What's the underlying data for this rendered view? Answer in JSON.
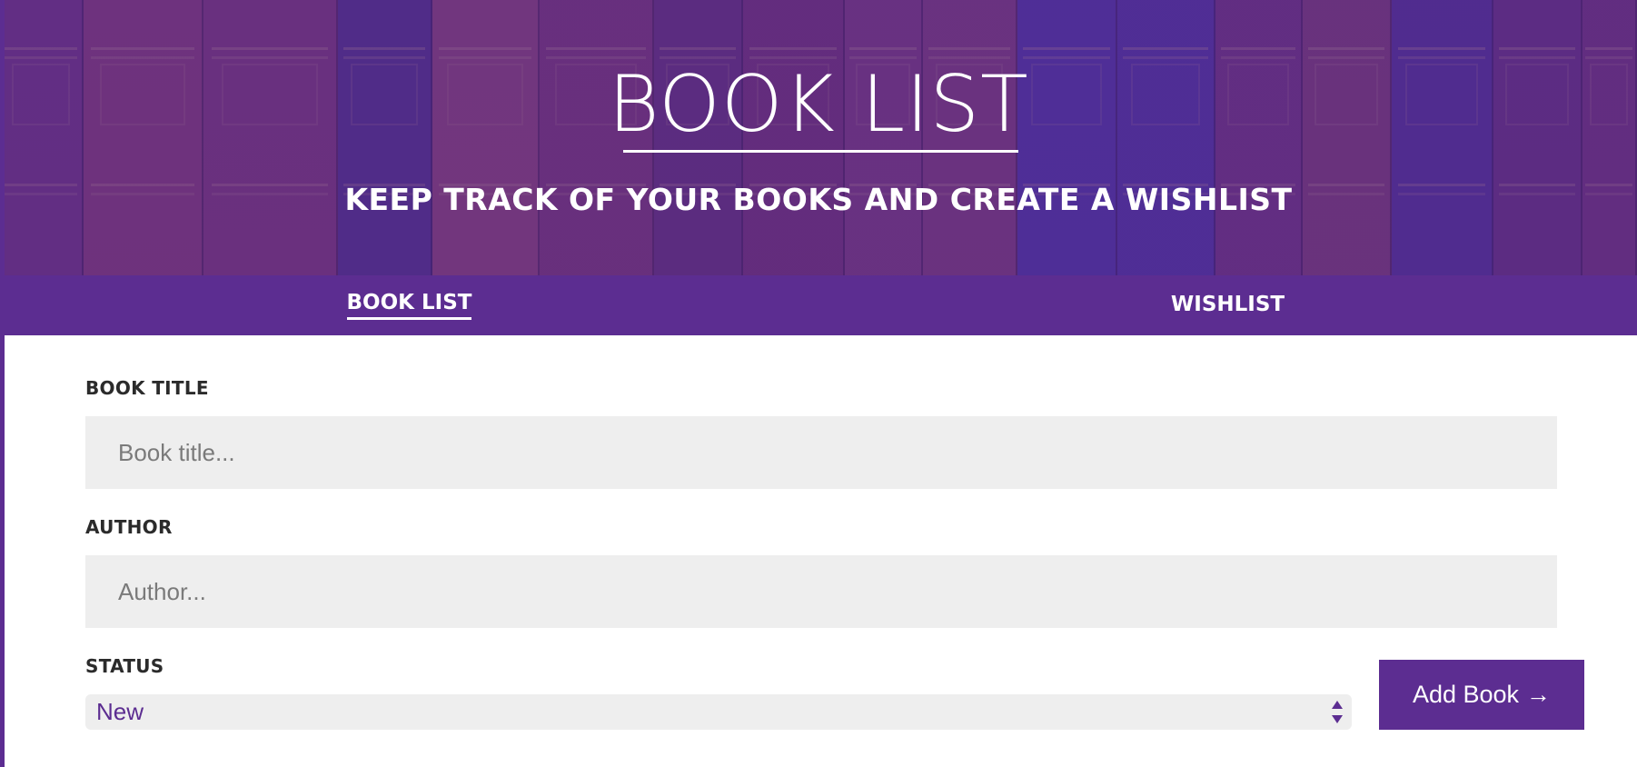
{
  "header": {
    "title": "BOOK LIST",
    "subtitle": "KEEP TRACK OF YOUR BOOKS AND CREATE A WISHLIST"
  },
  "nav": {
    "tabs": [
      {
        "label": "BOOK LIST",
        "active": true
      },
      {
        "label": "WISHLIST",
        "active": false
      }
    ]
  },
  "form": {
    "title": {
      "label": "BOOK TITLE",
      "placeholder": "Book title..."
    },
    "author": {
      "label": "AUTHOR",
      "placeholder": "Author..."
    },
    "status": {
      "label": "STATUS",
      "value": "New"
    },
    "submit": {
      "label": "Add Book",
      "icon": "arrow-right-icon",
      "glyph": "→"
    }
  },
  "colors": {
    "brand": "#5c2d91",
    "input_bg": "#eeeeee",
    "label_text": "#2b2b2b"
  }
}
